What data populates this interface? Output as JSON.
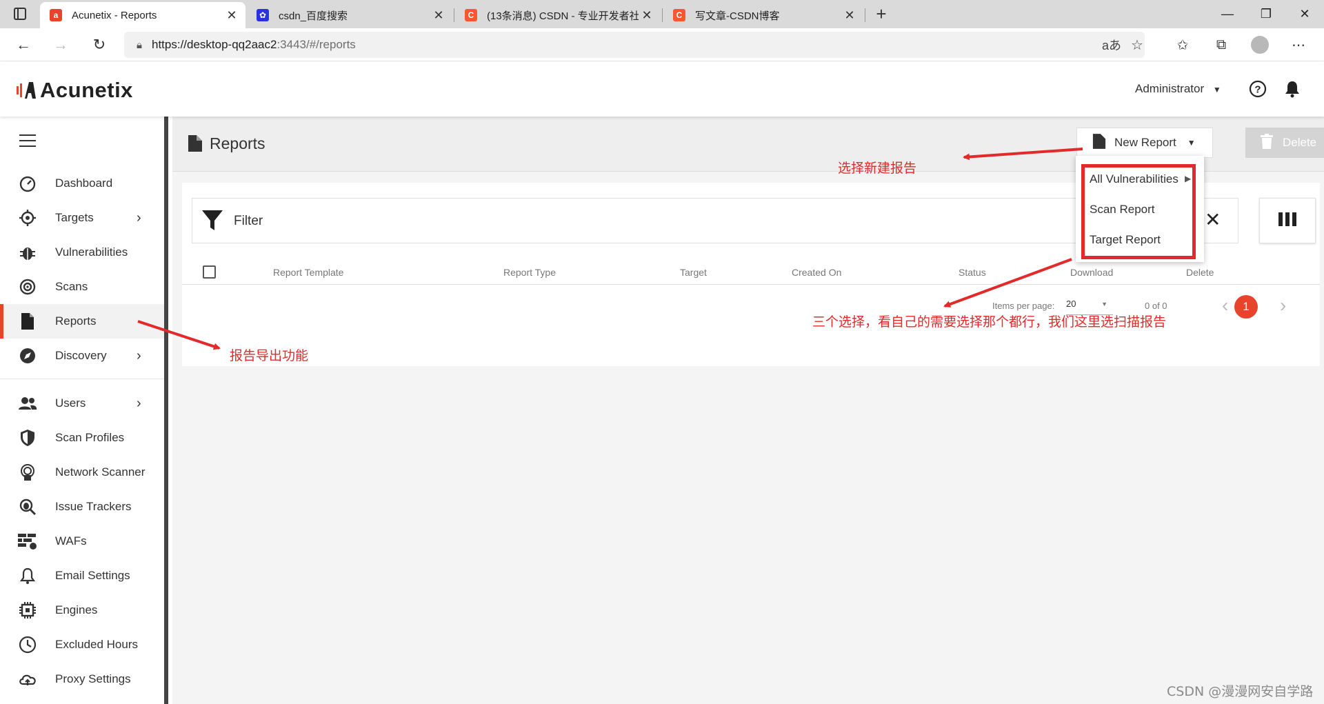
{
  "browser": {
    "tabs": [
      {
        "title": "Acunetix - Reports",
        "favicon": "acunetix-icon",
        "color": "#e8442b"
      },
      {
        "title": "csdn_百度搜索",
        "favicon": "baidu-paw-icon",
        "color": "#2932e1"
      },
      {
        "title": "(13条消息) CSDN - 专业开发者社",
        "favicon": "csdn-c-icon",
        "color": "#fc5531"
      },
      {
        "title": "写文章-CSDN博客",
        "favicon": "csdn-c-icon",
        "color": "#fc5531"
      }
    ],
    "url_host": "https://desktop-qq2aac2",
    "url_rest": ":3443/#/reports"
  },
  "app": {
    "logo": "Acunetix",
    "user": "Administrator"
  },
  "sidebar": {
    "items": [
      {
        "label": "Dashboard",
        "icon": "speedometer-icon"
      },
      {
        "label": "Targets",
        "icon": "crosshair-icon"
      },
      {
        "label": "Vulnerabilities",
        "icon": "bug-icon"
      },
      {
        "label": "Scans",
        "icon": "radar-icon"
      },
      {
        "label": "Reports",
        "icon": "document-icon"
      },
      {
        "label": "Discovery",
        "icon": "compass-icon"
      },
      {
        "label": "Users",
        "icon": "users-icon"
      },
      {
        "label": "Scan Profiles",
        "icon": "shield-icon"
      },
      {
        "label": "Network Scanner",
        "icon": "network-scanner-icon"
      },
      {
        "label": "Issue Trackers",
        "icon": "issue-tracker-icon"
      },
      {
        "label": "WAFs",
        "icon": "firewall-icon"
      },
      {
        "label": "Email Settings",
        "icon": "bell-icon"
      },
      {
        "label": "Engines",
        "icon": "chip-icon"
      },
      {
        "label": "Excluded Hours",
        "icon": "clock-icon"
      },
      {
        "label": "Proxy Settings",
        "icon": "cloud-upload-icon"
      }
    ]
  },
  "page": {
    "title": "Reports",
    "new_report": "New Report",
    "delete": "Delete",
    "filter": "Filter",
    "columns": [
      "Report Template",
      "Report Type",
      "Target",
      "Created On",
      "Status",
      "Download",
      "Delete"
    ],
    "items_per_page_label": "Items per page:",
    "items_per_page": "20",
    "range": "0 of 0",
    "current_page": "1"
  },
  "dropdown": {
    "items": [
      "All Vulnerabilities",
      "Scan Report",
      "Target Report"
    ]
  },
  "annotations": {
    "new_report_note": "选择新建报告",
    "reports_note": "报告导出功能",
    "options_note": "三个选择，看自己的需要选择那个都行，我们这里选扫描报告",
    "watermark": "CSDN @漫漫网安自学路"
  },
  "colors": {
    "accent": "#e8442b",
    "annotation": "#e32a2a"
  }
}
